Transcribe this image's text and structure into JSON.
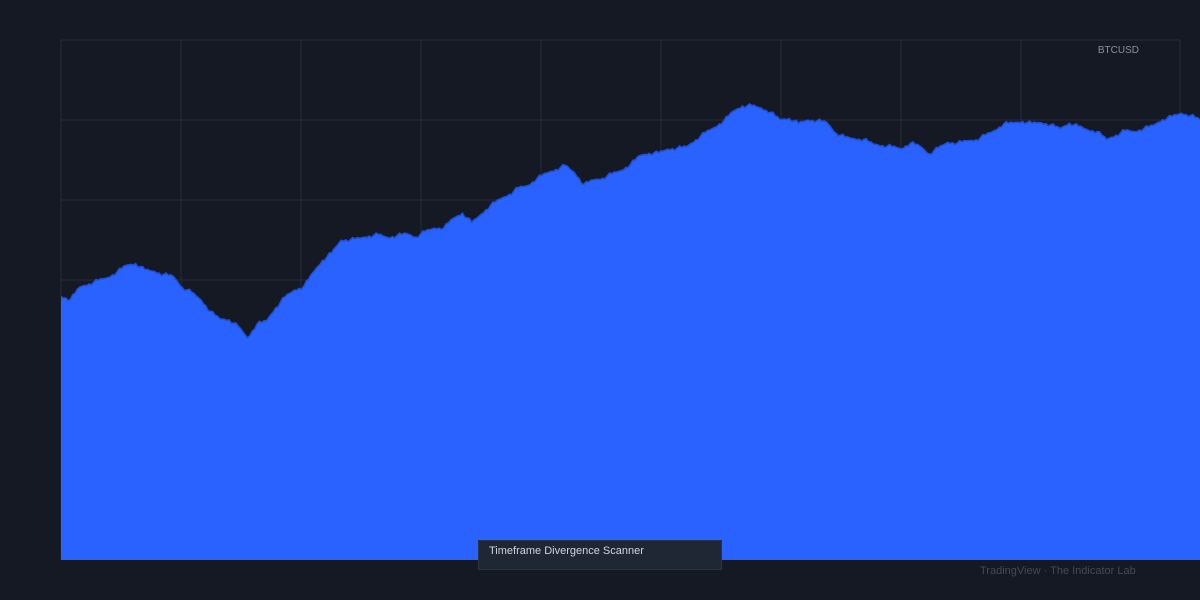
{
  "symbol": "BTCUSD",
  "indicator_name": "Timeframe Divergence Scanner",
  "watermark": "TradingView · The Indicator Lab",
  "colors": {
    "background": "#151924",
    "grid": "#262b38",
    "area_fill": "#2962ff",
    "area_edge": "#1f4fd6"
  },
  "chart_data": {
    "type": "area",
    "title": "",
    "xlabel": "",
    "ylabel": "",
    "grid": true,
    "ylim": [
      0,
      100
    ],
    "series": [
      {
        "values": [
          50.7,
          50.1,
          52.5,
          53.1,
          53.8,
          54.3,
          55.4,
          56.7,
          57.0,
          55.8,
          55.5,
          54.9,
          54.6,
          52.4,
          51.5,
          50.0,
          47.8,
          46.4,
          46.2,
          44.9,
          42.7,
          45.4,
          46.0,
          48.5,
          50.6,
          51.9,
          52.6,
          55.3,
          57.6,
          59.1,
          61.5,
          61.6,
          61.9,
          62.3,
          62.6,
          62.0,
          62.4,
          62.8,
          62.1,
          63.2,
          63.8,
          63.9,
          65.7,
          66.7,
          64.9,
          66.5,
          68.2,
          69.4,
          70.3,
          71.6,
          72.0,
          73.4,
          74.4,
          75.1,
          75.9,
          74.5,
          72.2,
          73.1,
          73.4,
          74.3,
          74.9,
          76.1,
          77.8,
          78.2,
          78.3,
          79.0,
          79.2,
          79.5,
          80.8,
          82.2,
          83.2,
          84.5,
          86.3,
          87.3,
          87.4,
          86.9,
          86.1,
          84.7,
          84.9,
          84.0,
          84.6,
          84.5,
          84.2,
          82.1,
          81.3,
          81.0,
          80.9,
          80.0,
          79.7,
          79.5,
          79.1,
          80.2,
          79.6,
          78.1,
          79.3,
          80.3,
          80.2,
          80.6,
          80.8,
          81.7,
          82.6,
          83.9,
          84.1,
          84.3,
          84.0,
          84.1,
          83.7,
          83.0,
          84.0,
          83.4,
          82.7,
          82.4,
          80.9,
          81.7,
          82.6,
          82.4,
          83.0,
          83.6,
          84.7,
          85.3,
          85.9,
          85.5,
          84.7
        ]
      }
    ]
  }
}
